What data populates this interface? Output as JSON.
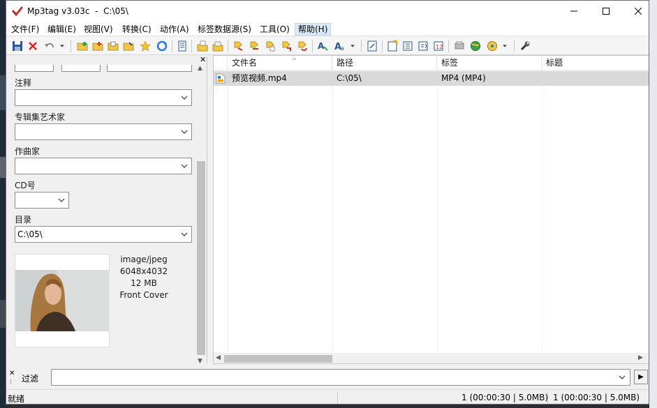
{
  "window": {
    "title": "Mp3tag v3.03c  -  C:\\05\\"
  },
  "menu": [
    {
      "label": "文件(F)"
    },
    {
      "label": "编辑(E)"
    },
    {
      "label": "视图(V)"
    },
    {
      "label": "转换(C)"
    },
    {
      "label": "动作(A)"
    },
    {
      "label": "标签数据源(S)"
    },
    {
      "label": "工具(O)"
    },
    {
      "label": "帮助(H)"
    }
  ],
  "toolbar_icons": [
    "save-icon",
    "remove-tag-icon",
    "undo-icon",
    "add-directory-icon",
    "change-directory-icon",
    "favorites-star-icon",
    "refresh-icon",
    "playlist-icon",
    "export-icon",
    "tag-source-icon",
    "actions-icon",
    "case-convert-icon",
    "extended-tags-icon",
    "text-file-icon",
    "settings-wrench-icon"
  ],
  "tag_panel": {
    "fields": [
      {
        "label": "注释",
        "value": ""
      },
      {
        "label": "专辑集艺术家",
        "value": ""
      },
      {
        "label": "作曲家",
        "value": ""
      },
      {
        "label": "CD号",
        "value": ""
      },
      {
        "label": "目录",
        "value": "C:\\05\\"
      }
    ],
    "cover_art": {
      "mime": "image/jpeg",
      "dimensions": "6048x4032",
      "size": "12 MB",
      "type": "Front Cover"
    }
  },
  "file_list": {
    "columns": [
      "文件名",
      "路径",
      "标签",
      "标题"
    ],
    "rows": [
      {
        "filename": "预览视频.mp4",
        "path": "C:\\05\\",
        "tag": "MP4 (MP4)",
        "title": ""
      }
    ]
  },
  "filter": {
    "label": "过滤",
    "value": ""
  },
  "status": {
    "text": "就绪",
    "selected": "1 (00:00:30 | 5.0MB)",
    "total": "1 (00:00:30 | 5.0MB)"
  },
  "colors": {
    "selected_row": "#d9d9d9",
    "active_menu": "#dbe8f7"
  }
}
